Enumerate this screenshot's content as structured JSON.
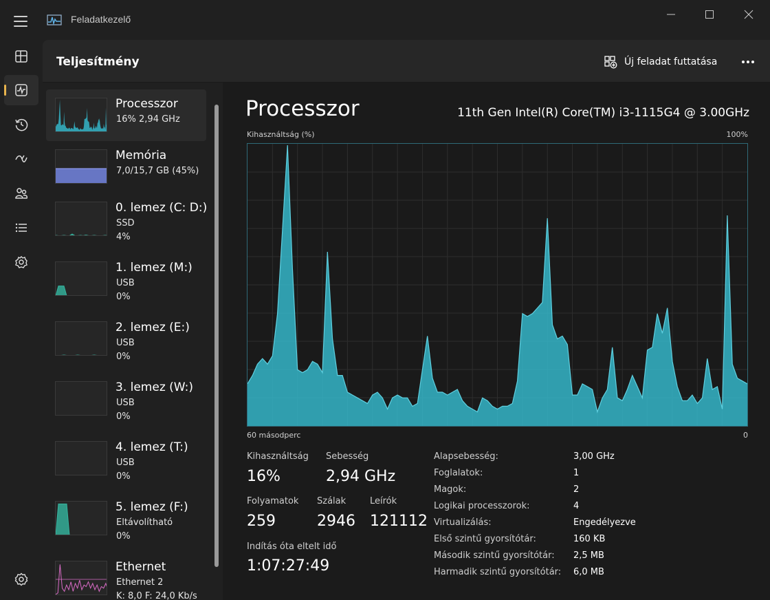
{
  "window": {
    "title": "Feladatkezelő",
    "controls": [
      "minimize",
      "maximize",
      "close"
    ]
  },
  "nav_rail": {
    "items": [
      {
        "icon": "processes-icon",
        "active": false
      },
      {
        "icon": "performance-icon",
        "active": true
      },
      {
        "icon": "app-history-icon",
        "active": false
      },
      {
        "icon": "startup-apps-icon",
        "active": false
      },
      {
        "icon": "users-icon",
        "active": false
      },
      {
        "icon": "details-icon",
        "active": false
      },
      {
        "icon": "services-icon",
        "active": false
      },
      {
        "icon": "settings-icon",
        "active": false
      }
    ]
  },
  "header": {
    "title": "Teljesítmény",
    "run_task_label": "Új feladat futtatása"
  },
  "sidebar": {
    "items": [
      {
        "name": "Processzor",
        "line1": "16%  2,94 GHz",
        "line2": "",
        "color": "#35b6c9",
        "active": true
      },
      {
        "name": "Memória",
        "line1": "7,0/15,7 GB (45%)",
        "line2": "",
        "color": "#6f7fd6",
        "active": false
      },
      {
        "name": "0. lemez (C: D:)",
        "line1": "SSD",
        "line2": "4%",
        "color": "#35b6a0",
        "active": false
      },
      {
        "name": "1. lemez (M:)",
        "line1": "USB",
        "line2": "0%",
        "color": "#35b6a0",
        "active": false
      },
      {
        "name": "2. lemez (E:)",
        "line1": "USB",
        "line2": "0%",
        "color": "#35b6a0",
        "active": false
      },
      {
        "name": "3. lemez (W:)",
        "line1": "USB",
        "line2": "0%",
        "color": "#35b6a0",
        "active": false
      },
      {
        "name": "4. lemez (T:)",
        "line1": "USB",
        "line2": "0%",
        "color": "#35b6a0",
        "active": false
      },
      {
        "name": "5. lemez (F:)",
        "line1": "Eltávolítható",
        "line2": "0%",
        "color": "#35b6a0",
        "active": false
      },
      {
        "name": "Ethernet",
        "line1": "Ethernet 2",
        "line2": "K: 8,0  F: 24,0 Kb/s",
        "color": "#d96bc6",
        "active": false
      }
    ]
  },
  "cpu": {
    "title": "Processzor",
    "model": "11th Gen Intel(R) Core(TM) i3-1115G4 @ 3.00GHz",
    "graph": {
      "label_top_left": "Kihasználtság (%)",
      "label_top_right": "100%",
      "label_bottom_left": "60 másodperc",
      "label_bottom_right": "0",
      "color": "#35b6c9",
      "y_range": [
        0,
        100
      ],
      "x_seconds": 60,
      "values": [
        15,
        18,
        22,
        24,
        22,
        25,
        40,
        70,
        100,
        56,
        20,
        19,
        20,
        23,
        22,
        19,
        62,
        31,
        18,
        18,
        12,
        11,
        10,
        9,
        8,
        11,
        12,
        10,
        6,
        10,
        11,
        10,
        10,
        7,
        8,
        20,
        32,
        17,
        12,
        12,
        11,
        12,
        13,
        9,
        7,
        6,
        5,
        10,
        9,
        7,
        6,
        7,
        7,
        8,
        16,
        40,
        39,
        40,
        42,
        44,
        74,
        36,
        31,
        32,
        29,
        11,
        11,
        15,
        14,
        13,
        5,
        10,
        13,
        28,
        10,
        9,
        13,
        18,
        14,
        10,
        27,
        28,
        40,
        33,
        42,
        23,
        14,
        9,
        9,
        11,
        8,
        10,
        24,
        13,
        14,
        6,
        75,
        22,
        17,
        16,
        15
      ]
    },
    "stats": {
      "utilization_label": "Kihasználtság",
      "utilization_value": "16%",
      "speed_label": "Sebesség",
      "speed_value": "2,94 GHz",
      "processes_label": "Folyamatok",
      "processes_value": "259",
      "threads_label": "Szálak",
      "threads_value": "2946",
      "handles_label": "Leírók",
      "handles_value": "121112",
      "uptime_label": "Indítás óta eltelt idő",
      "uptime_value": "1:07:27:49"
    },
    "specs": [
      {
        "label": "Alapsebesség:",
        "value": "3,00 GHz"
      },
      {
        "label": "Foglalatok:",
        "value": "1"
      },
      {
        "label": "Magok:",
        "value": "2"
      },
      {
        "label": "Logikai processzorok:",
        "value": "4"
      },
      {
        "label": "Virtualizálás:",
        "value": "Engedélyezve"
      },
      {
        "label": "Első szintű gyorsítótár:",
        "value": "160 KB"
      },
      {
        "label": "Második szintű gyorsítótár:",
        "value": "2,5 MB"
      },
      {
        "label": "Harmadik szintű gyorsítótár:",
        "value": "6,0 MB"
      }
    ]
  }
}
